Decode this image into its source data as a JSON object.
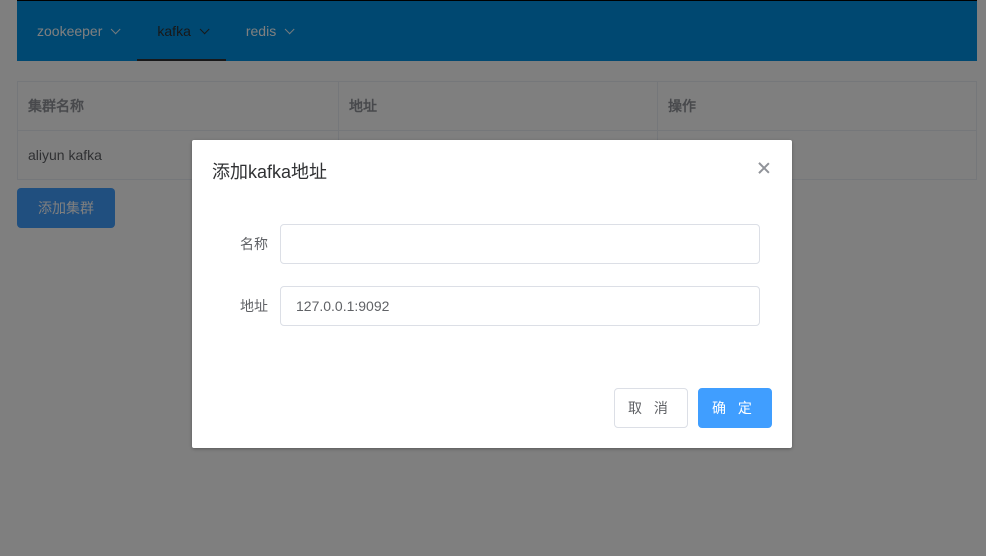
{
  "nav": {
    "items": [
      {
        "label": "zookeeper"
      },
      {
        "label": "kafka"
      },
      {
        "label": "redis"
      }
    ],
    "active_index": 1
  },
  "table": {
    "headers": [
      "集群名称",
      "地址",
      "操作"
    ],
    "rows": [
      [
        "aliyun kafka",
        "",
        ""
      ]
    ]
  },
  "add_cluster_button": "添加集群",
  "dialog": {
    "title": "添加kafka地址",
    "fields": [
      {
        "label": "名称",
        "value": "",
        "placeholder": ""
      },
      {
        "label": "地址",
        "value": "127.0.0.1:9092",
        "placeholder": ""
      }
    ],
    "cancel_label": "取 消",
    "confirm_label": "确 定"
  },
  "colors": {
    "nav_bg": "#0091e2",
    "primary": "#409eff"
  }
}
